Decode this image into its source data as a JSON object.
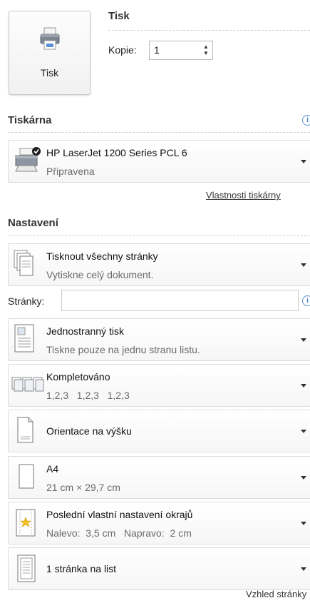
{
  "print": {
    "section_title": "Tisk",
    "button_label": "Tisk",
    "copies_label": "Kopie:",
    "copies_value": "1"
  },
  "printer": {
    "section_title": "Tiskárna",
    "name": "HP LaserJet 1200 Series PCL 6",
    "status": "Připravena",
    "properties_link": "Vlastnosti tiskárny"
  },
  "settings": {
    "section_title": "Nastavení",
    "pages_label": "Stránky:",
    "pages_value": "",
    "items": [
      {
        "title": "Tisknout všechny stránky",
        "subtitle": "Vytiskne celý dokument.",
        "icon": "pages-stack-icon"
      },
      {
        "title": "Jednostranný tisk",
        "subtitle": "Tiskne pouze na jednu stranu listu.",
        "icon": "one-sided-icon"
      },
      {
        "title": "Kompletováno",
        "subtitle": "1,2,3   1,2,3   1,2,3",
        "icon": "collated-icon"
      },
      {
        "title": "Orientace na výšku",
        "subtitle": "",
        "icon": "portrait-icon"
      },
      {
        "title": "A4",
        "subtitle": "21 cm × 29,7 cm",
        "icon": "paper-size-icon"
      },
      {
        "title": "Poslední vlastní nastavení okrajů",
        "subtitle": "Nalevo:  3,5 cm   Napravo:  2 cm",
        "icon": "margins-icon"
      },
      {
        "title": "1 stránka na list",
        "subtitle": "",
        "icon": "pages-per-sheet-icon"
      }
    ],
    "page_setup_link": "Vzhled stránky"
  },
  "colors": {
    "accent": "#4b7fc9",
    "border": "#dcdcdc",
    "text": "#333333"
  }
}
